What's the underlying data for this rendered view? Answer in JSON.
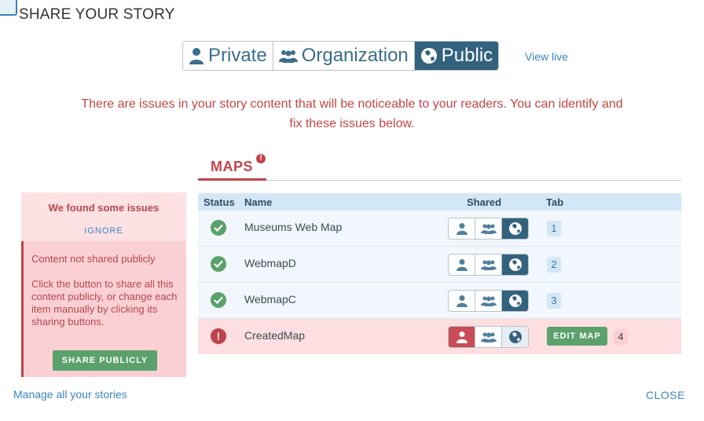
{
  "header": {
    "title": "SHARE YOUR STORY"
  },
  "visibility": {
    "options": [
      {
        "label": "Private",
        "icon": "person-icon"
      },
      {
        "label": "Organization",
        "icon": "group-icon"
      },
      {
        "label": "Public",
        "icon": "globe-icon"
      }
    ],
    "selected": "Public",
    "view_live": "View live"
  },
  "warning": {
    "message": "There are issues in your story content that will be noticeable to your readers. You can identify and fix these issues below."
  },
  "maps_tab": {
    "label": "MAPS",
    "badge": "!"
  },
  "table": {
    "columns": {
      "status": "Status",
      "name": "Name",
      "shared": "Shared",
      "tab": "Tab"
    },
    "rows": [
      {
        "name": "Museums Web Map",
        "status": "ok",
        "shared": "public",
        "tab": "1"
      },
      {
        "name": "WebmapD",
        "status": "ok",
        "shared": "public",
        "tab": "2"
      },
      {
        "name": "WebmapC",
        "status": "ok",
        "shared": "public",
        "tab": "3"
      },
      {
        "name": "CreatedMap",
        "status": "error",
        "shared": "private",
        "tab": "4",
        "action": "EDIT MAP"
      }
    ]
  },
  "issues_panel": {
    "heading": "We found some issues",
    "ignore": "IGNORE",
    "issue_title": "Content not shared publicly",
    "issue_text": "Click the button to share all this content publicly, or change each item manually by clicking its sharing buttons.",
    "button": "SHARE PUBLICLY"
  },
  "footer": {
    "manage_link": "Manage all your stories",
    "close": "CLOSE"
  },
  "colors": {
    "accent": "#33627e",
    "error": "#c0434b",
    "success": "#5ba16b",
    "link": "#3b86c2"
  }
}
